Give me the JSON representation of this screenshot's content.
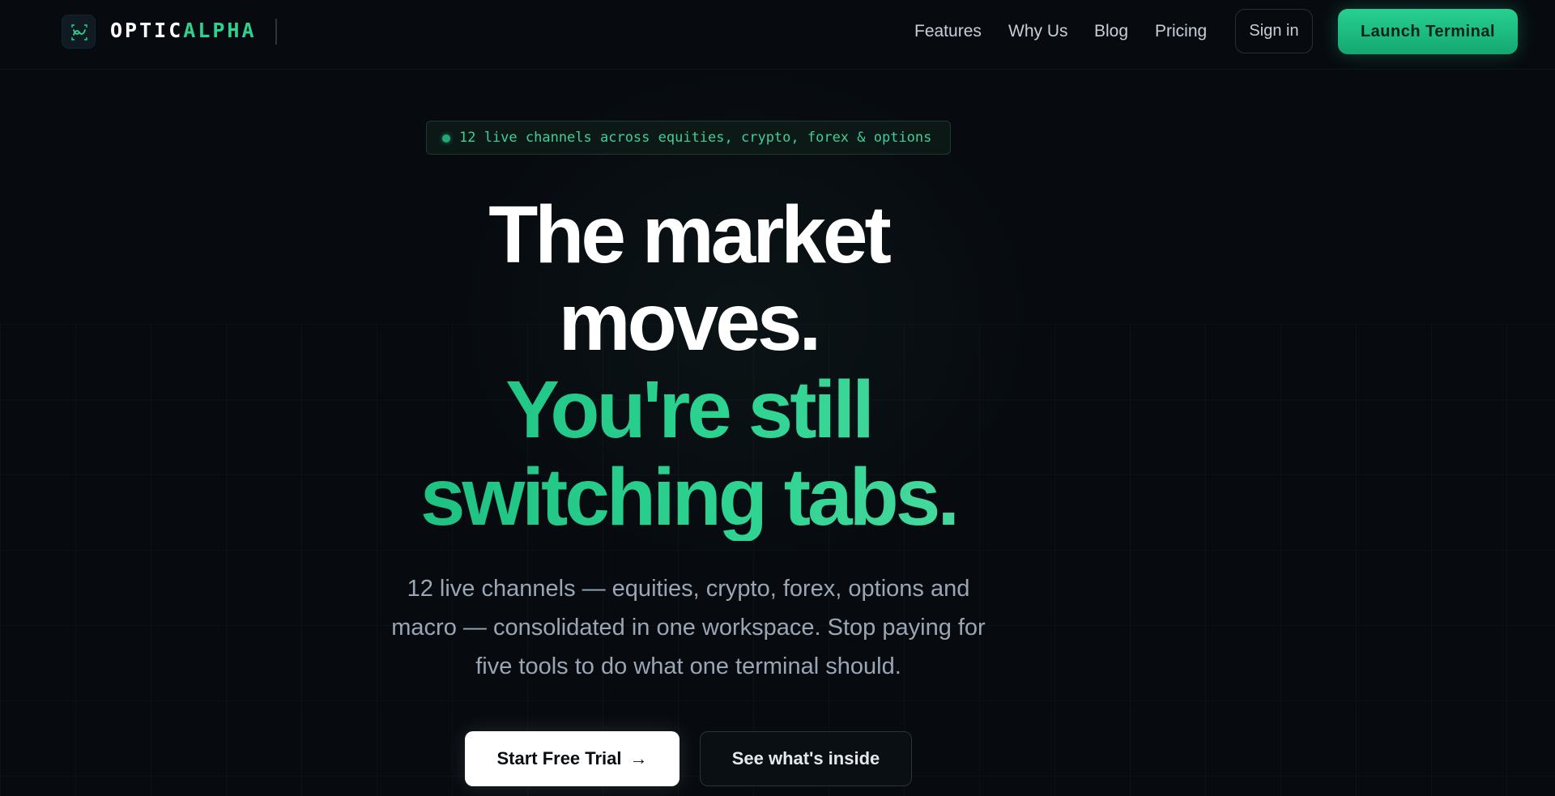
{
  "nav": {
    "brand_part1": "OPTIC",
    "brand_part2": "ALPHA",
    "logo_icon": "infinity-chart-icon",
    "links": [
      "Features",
      "Why Us",
      "Blog",
      "Pricing"
    ],
    "signin_label": "Sign in",
    "launch_label": "Launch Terminal"
  },
  "badge": {
    "text": "12 live channels across equities, crypto, forex & options"
  },
  "hero": {
    "line1": "The market",
    "line2": "moves.",
    "line3": "You're still",
    "line4": "switching tabs.",
    "subtitle_line1": "12 live channels — equities, crypto, forex, options and",
    "subtitle_line2": "macro — consolidated in one workspace. Stop paying for",
    "subtitle_line3": "five tools to do what one terminal should.",
    "primary_cta": "Start Free Trial",
    "primary_cta_icon": "arrow-right-icon",
    "secondary_cta": "See what's inside"
  },
  "colors": {
    "background": "#070b10",
    "accent": "#27d08f",
    "text_primary": "#ffffff",
    "text_muted": "#9aa6b4"
  }
}
